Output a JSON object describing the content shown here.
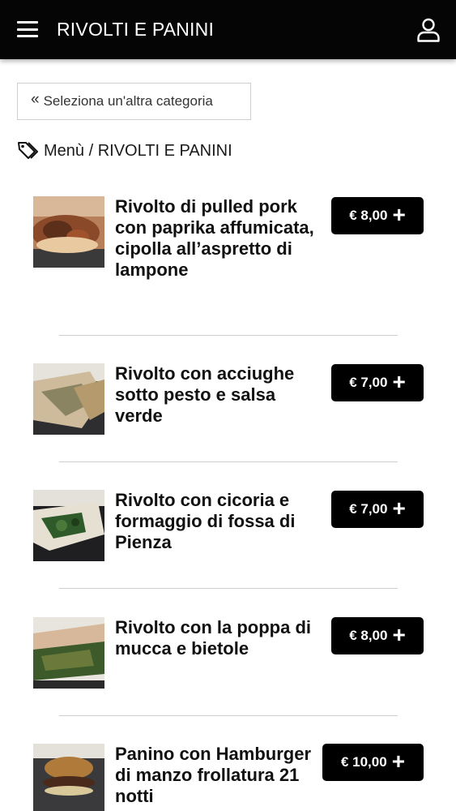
{
  "header": {
    "title": "RIVOLTI E PANINI",
    "menu_icon": "hamburger-icon",
    "user_icon": "user-icon"
  },
  "back_button": {
    "label": "Seleziona un'altra categoria",
    "icon": "double-chevron-left-icon"
  },
  "breadcrumb": {
    "icon": "tag-icon",
    "root": "Menù",
    "separator": "/",
    "current": "RIVOLTI E PANINI"
  },
  "items": [
    {
      "name": "Rivolto di pulled pork con paprika affumicata, cipolla all’aspretto di lampone",
      "price": "€ 8,00"
    },
    {
      "name": "Rivolto con acciughe sotto pesto e salsa verde",
      "price": "€ 7,00"
    },
    {
      "name": "Rivolto con cicoria e formaggio di fossa di Pienza",
      "price": "€ 7,00"
    },
    {
      "name": "Rivolto con la poppa di mucca e bietole",
      "price": "€ 8,00"
    },
    {
      "name": "Panino con Hamburger di manzo frollatura 21 notti",
      "price": "€ 10,00"
    }
  ],
  "colors": {
    "header_bg": "#050505",
    "price_button_bg": "#000000",
    "divider": "#cfcfcf"
  }
}
